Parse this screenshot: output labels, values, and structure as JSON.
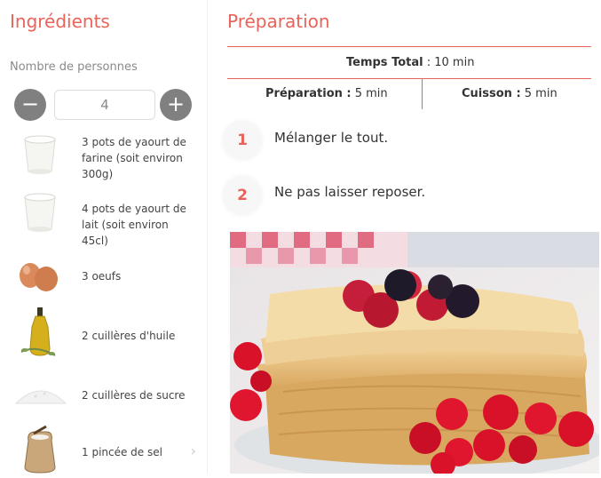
{
  "ingredients_panel": {
    "title": "Ingrédients",
    "persons_label": "Nombre de personnes",
    "minus_label": "−",
    "plus_label": "+",
    "quantity": "4",
    "items": [
      {
        "text": "3 pots de yaourt de farine (soit environ 300g)",
        "icon": "yogurt-pot-icon"
      },
      {
        "text": "4 pots de yaourt de lait (soit environ 45cl)",
        "icon": "yogurt-pot-icon"
      },
      {
        "text": "3 oeufs",
        "icon": "eggs-icon"
      },
      {
        "text": "2 cuillères d'huile",
        "icon": "oil-bottle-icon"
      },
      {
        "text": "2 cuillères de sucre",
        "icon": "sugar-icon"
      },
      {
        "text": "1 pincée de sel",
        "icon": "salt-sack-icon"
      }
    ],
    "more_chevron": "›"
  },
  "preparation_panel": {
    "title": "Préparation",
    "total_time_label": "Temps Total",
    "total_time_value": " : 10 min",
    "prep_label": "Préparation :",
    "prep_value": " 5 min",
    "cook_label": "Cuisson :",
    "cook_value": " 5 min",
    "steps": [
      {
        "number": "1",
        "text": "Mélanger le tout."
      },
      {
        "number": "2",
        "text": "Ne pas laisser reposer."
      }
    ]
  },
  "colors": {
    "accent": "#e8645a",
    "stepper_button": "#808080",
    "muted_text": "#8a8a8a"
  }
}
